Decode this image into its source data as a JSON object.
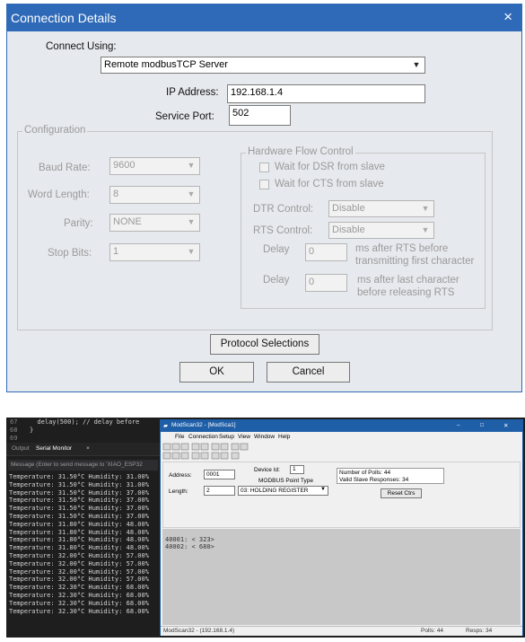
{
  "dialog": {
    "title": "Connection Details",
    "close_icon": "×",
    "connect_using_label": "Connect Using:",
    "connect_using_value": "Remote modbusTCP Server",
    "ip_label": "IP Address:",
    "ip_value": "192.168.1.4",
    "port_label": "Service Port:",
    "port_value": "502",
    "configuration": {
      "title": "Configuration",
      "baud_label": "Baud Rate:",
      "baud_value": "9600",
      "word_label": "Word Length:",
      "word_value": "8",
      "parity_label": "Parity:",
      "parity_value": "NONE",
      "stop_label": "Stop Bits:",
      "stop_value": "1",
      "hwfc": {
        "title": "Hardware Flow Control",
        "dsr_label": "Wait for DSR from slave",
        "cts_label": "Wait for CTS from slave",
        "dtr_label": "DTR Control:",
        "dtr_value": "Disable",
        "rts_label": "RTS Control:",
        "rts_value": "Disable",
        "delay1_label": "Delay",
        "delay1_value": "0",
        "delay1_desc_1": "ms after RTS before",
        "delay1_desc_2": "transmitting first character",
        "delay2_label": "Delay",
        "delay2_value": "0",
        "delay2_desc_1": "ms after last character",
        "delay2_desc_2": "before releasing RTS"
      }
    },
    "protocol_button": "Protocol Selections",
    "ok_button": "OK",
    "cancel_button": "Cancel"
  },
  "ide": {
    "code_lines": [
      {
        "num": "67",
        "text": "  delay(500); // delay before"
      },
      {
        "num": "68",
        "text": "}"
      },
      {
        "num": "69",
        "text": ""
      }
    ],
    "tab_output": "Output",
    "tab_serial": "Serial Monitor",
    "tab_close": "×",
    "message_placeholder": "Message (Enter to send message to 'XIAO_ESP32",
    "serial_lines": [
      "Temperature: 31.50°C Humidity: 31.00%",
      "Temperature: 31.50°C Humidity: 31.00%",
      "Temperature: 31.50°C Humidity: 37.00%",
      "Temperature: 31.50°C Humidity: 37.00%",
      "Temperature: 31.50°C Humidity: 37.00%",
      "Temperature: 31.50°C Humidity: 37.00%",
      "Temperature: 31.80°C Humidity: 48.00%",
      "Temperature: 31.80°C Humidity: 48.00%",
      "Temperature: 31.80°C Humidity: 48.00%",
      "Temperature: 31.80°C Humidity: 48.00%",
      "Temperature: 32.00°C Humidity: 57.00%",
      "Temperature: 32.00°C Humidity: 57.00%",
      "Temperature: 32.00°C Humidity: 57.00%",
      "Temperature: 32.00°C Humidity: 57.00%",
      "Temperature: 32.30°C Humidity: 68.00%",
      "Temperature: 32.30°C Humidity: 68.00%",
      "Temperature: 32.30°C Humidity: 68.00%",
      "Temperature: 32.30°C Humidity: 68.00%"
    ]
  },
  "modscan": {
    "title": "ModScan32 - [ModSca1]",
    "menu": [
      "File",
      "Connection",
      "Setup",
      "View",
      "Window",
      "Help"
    ],
    "window_controls": [
      "–",
      "□",
      "✕"
    ],
    "address_label": "Address:",
    "address_value": "0001",
    "length_label": "Length:",
    "length_value": "2",
    "device_id_label": "Device Id:",
    "device_id_value": "1",
    "point_type_label": "MODBUS Point Type",
    "point_type_value": "03: HOLDING REGISTER",
    "polls_text": "Number of Polls: 44",
    "responses_text": "Valid Slave Responses: 34",
    "reset_button": "Reset Ctrs",
    "registers": [
      "40001:  <    323>",
      "40002:  <    680>"
    ],
    "status_left": "ModScan32 - (192.168.1.4)",
    "status_polls": "Polls: 44",
    "status_resps": "Resps: 34"
  }
}
